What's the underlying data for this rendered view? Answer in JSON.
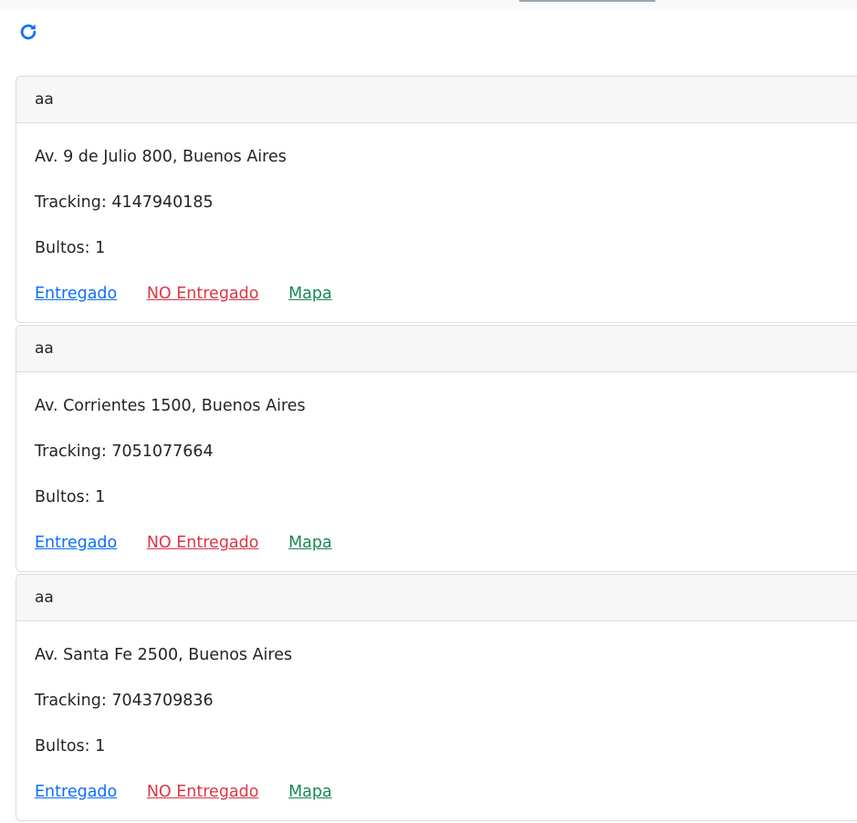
{
  "toolbar": {
    "refresh_icon": "refresh-icon",
    "refresh_color": "#0d6efd"
  },
  "colors": {
    "entregado": "#0d6efd",
    "no_entregado": "#dc3545",
    "mapa": "#198754"
  },
  "cards": [
    {
      "header": "aa",
      "address": "Av. 9 de Julio 800, Buenos Aires",
      "tracking": "Tracking: 4147940185",
      "bultos": "Bultos: 1",
      "actions": {
        "entregado": "Entregado",
        "no_entregado": "NO Entregado",
        "mapa": "Mapa"
      }
    },
    {
      "header": "aa",
      "address": "Av. Corrientes 1500, Buenos Aires",
      "tracking": "Tracking: 7051077664",
      "bultos": "Bultos: 1",
      "actions": {
        "entregado": "Entregado",
        "no_entregado": "NO Entregado",
        "mapa": "Mapa"
      }
    },
    {
      "header": "aa",
      "address": "Av. Santa Fe 2500, Buenos Aires",
      "tracking": "Tracking: 7043709836",
      "bultos": "Bultos: 1",
      "actions": {
        "entregado": "Entregado",
        "no_entregado": "NO Entregado",
        "mapa": "Mapa"
      }
    }
  ]
}
